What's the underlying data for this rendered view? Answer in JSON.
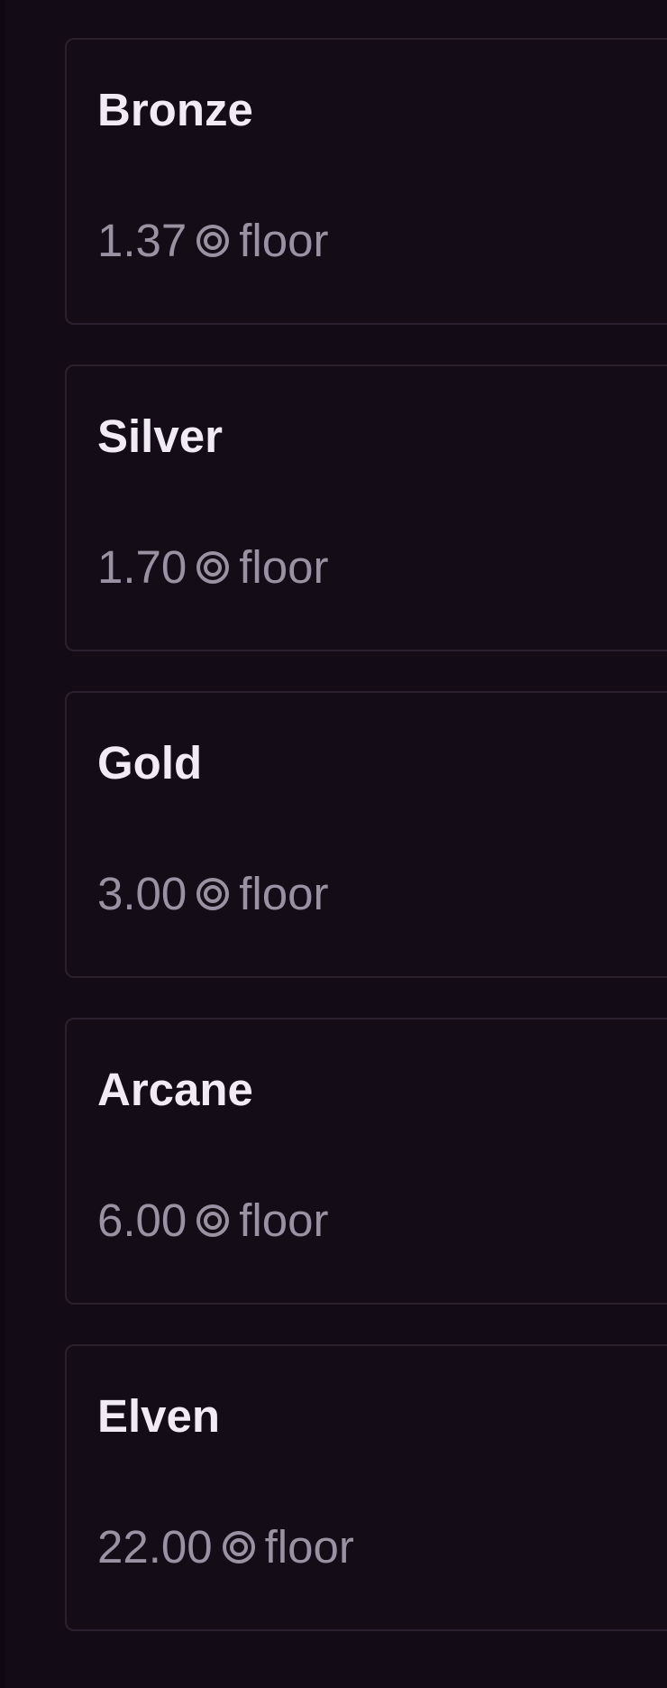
{
  "colors": {
    "background": "#130c17",
    "card_border": "#2a2030",
    "tier_name": "#f1ecf4",
    "floor_text": "#9a91a2"
  },
  "tiers": [
    {
      "name": "Bronze",
      "floor_value": "1.37",
      "currency_icon": "coin-icon",
      "floor_label": "floor"
    },
    {
      "name": "Silver",
      "floor_value": "1.70",
      "currency_icon": "coin-icon",
      "floor_label": "floor"
    },
    {
      "name": "Gold",
      "floor_value": "3.00",
      "currency_icon": "coin-icon",
      "floor_label": "floor"
    },
    {
      "name": "Arcane",
      "floor_value": "6.00",
      "currency_icon": "coin-icon",
      "floor_label": "floor"
    },
    {
      "name": "Elven",
      "floor_value": "22.00",
      "currency_icon": "coin-icon",
      "floor_label": "floor"
    }
  ]
}
